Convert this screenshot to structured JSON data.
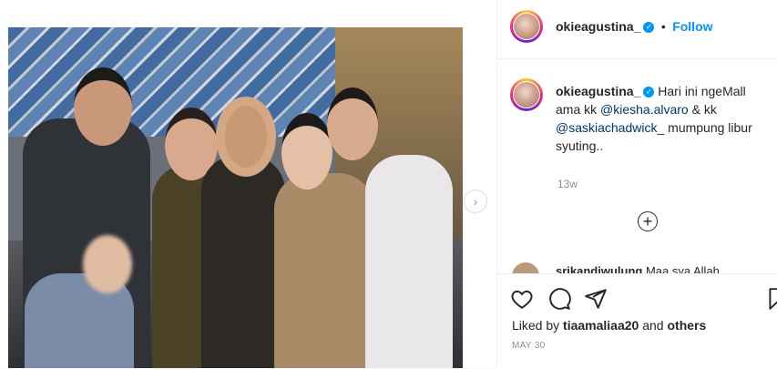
{
  "post": {
    "username": "okieagustina_",
    "follow_label": "Follow",
    "separator": "•",
    "caption_prefix": "Hari ini ngeMall ama kk ",
    "mention_1": "@kiesha.alvaro",
    "caption_mid": " & kk ",
    "mention_2": "@saskiachadwick_",
    "caption_suffix": " mumpung libur syuting..",
    "time_ago": "13w",
    "comment_preview_user": "srikandiwulung",
    "comment_preview_text": "Maa sya Allah",
    "liked_by_prefix": "Liked by ",
    "liked_by_user": "tiaamaliaa20",
    "liked_by_and": " and ",
    "liked_by_others": "others",
    "date": "MAY 30"
  },
  "icons": {
    "verified": "verified-badge-icon",
    "like": "heart-icon",
    "comment": "comment-icon",
    "share": "paper-plane-icon",
    "save": "bookmark-icon",
    "more_comments": "plus-circle-icon",
    "next": "chevron-right-icon"
  },
  "colors": {
    "link": "#0095f6",
    "mention": "#00376b",
    "muted": "#8e8e8e",
    "text": "#262626"
  }
}
